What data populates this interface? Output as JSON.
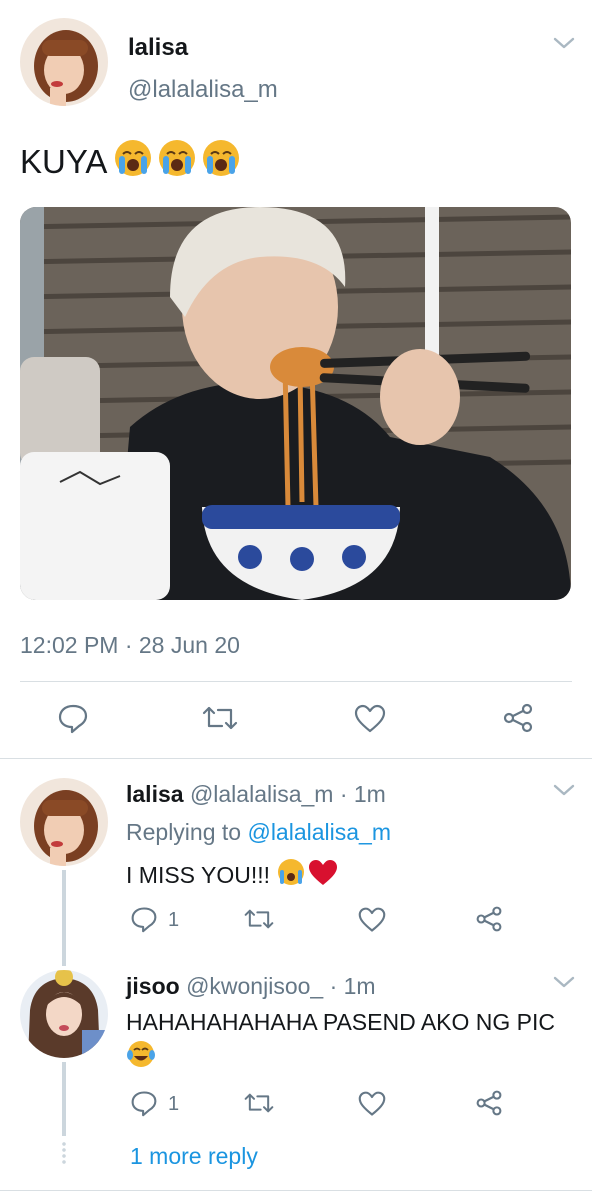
{
  "tweet": {
    "name": "lalisa",
    "handle": "@lalalalisa_m",
    "text": "KUYA",
    "timestamp": "12:02 PM · 28 Jun 20"
  },
  "replies": [
    {
      "name": "lalisa",
      "handle": "@lalalalisa_m",
      "time": "· 1m",
      "replying_label": "Replying to",
      "replying_to": "@lalalalisa_m",
      "text": "I MISS YOU!!!",
      "reply_count": "1"
    },
    {
      "name": "jisoo",
      "handle": "@kwonjisoo_",
      "time": "· 1m",
      "text": "HAHAHAHAHAHA PASEND AKO NG PIC",
      "reply_count": "1"
    }
  ],
  "more_replies": "1 more reply",
  "colors": {
    "link": "#1b95e0",
    "muted": "#657786",
    "divider": "#d9dfe3"
  }
}
